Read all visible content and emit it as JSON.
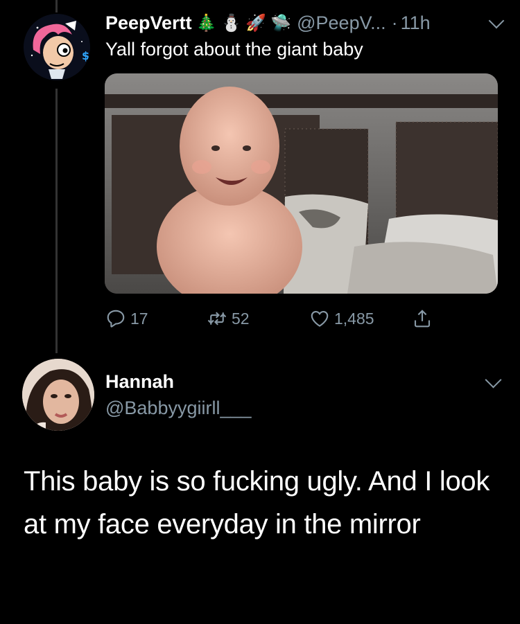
{
  "tweet1": {
    "display_name": "PeepVertt",
    "name_emojis": [
      "🎄",
      "⛄",
      "🚀",
      "🛸"
    ],
    "handle": "@PeepV...",
    "separator": "·",
    "time": "11h",
    "text": "Yall forgot about the giant baby",
    "media": {
      "icon": "video-thumbnail-baby"
    },
    "actions": {
      "replies": "17",
      "retweets": "52",
      "likes": "1,485"
    }
  },
  "tweet2": {
    "display_name": "Hannah",
    "handle": "@Babbyygiirll___",
    "text": "This baby is so fucking ugly. And I look at my face everyday in the mirror"
  },
  "colors": {
    "background": "#000000",
    "secondary_text": "#8899a6",
    "thread_line": "#333333"
  }
}
